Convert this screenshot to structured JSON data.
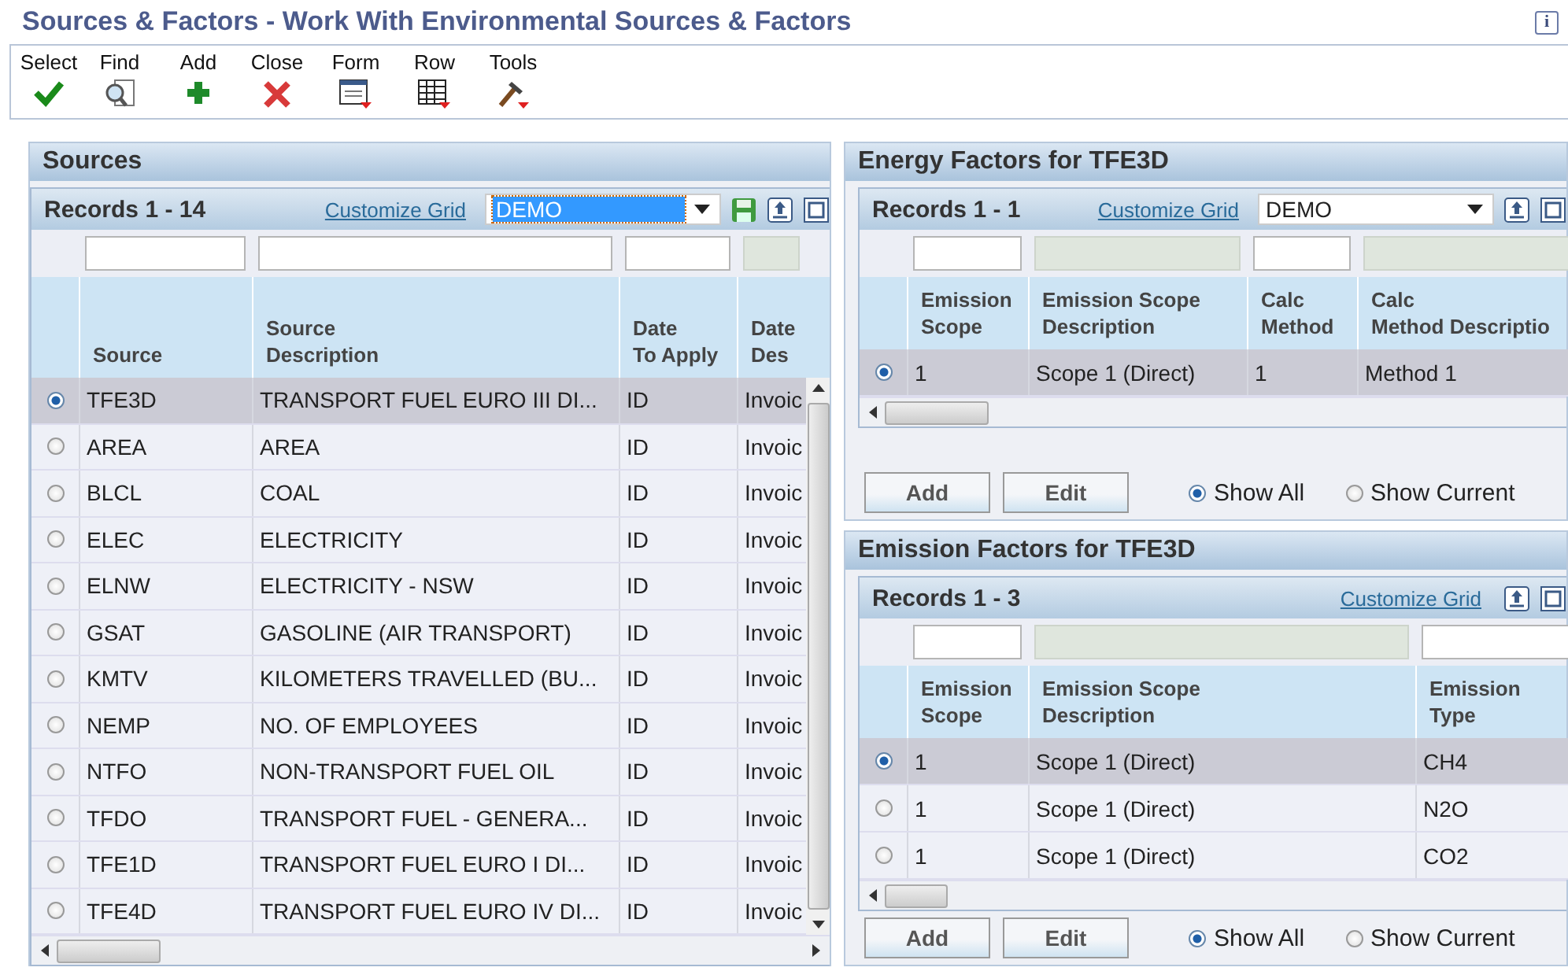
{
  "window": {
    "title": "Sources & Factors - Work With Environmental Sources & Factors",
    "info_icon": "i"
  },
  "toolbar": [
    {
      "label": "Select",
      "kind": "check"
    },
    {
      "label": "Find",
      "kind": "find"
    },
    {
      "label": "Add",
      "kind": "add"
    },
    {
      "label": "Close",
      "kind": "close"
    },
    {
      "label": "Form",
      "kind": "form"
    },
    {
      "label": "Row",
      "kind": "row"
    },
    {
      "label": "Tools",
      "kind": "tools"
    }
  ],
  "sources": {
    "title": "Sources",
    "records": "Records 1 - 14",
    "customize": "Customize Grid",
    "grid_format": {
      "value": "DEMO",
      "focused": true
    },
    "columns": [
      {
        "label": "Source",
        "filter_disabled": false
      },
      {
        "label": "Source\nDescription",
        "filter_disabled": false
      },
      {
        "label": "Date\nTo Apply",
        "filter_disabled": false
      },
      {
        "label": "Date\nDes",
        "filter_disabled": true
      }
    ],
    "rows": [
      {
        "selected": true,
        "cells": [
          "TFE3D",
          "TRANSPORT FUEL EURO III DI...",
          "ID",
          "Invoic"
        ]
      },
      {
        "selected": false,
        "cells": [
          "AREA",
          "AREA",
          "ID",
          "Invoic"
        ]
      },
      {
        "selected": false,
        "cells": [
          "BLCL",
          "COAL",
          "ID",
          "Invoic"
        ]
      },
      {
        "selected": false,
        "cells": [
          "ELEC",
          "ELECTRICITY",
          "ID",
          "Invoic"
        ]
      },
      {
        "selected": false,
        "cells": [
          "ELNW",
          "ELECTRICITY - NSW",
          "ID",
          "Invoic"
        ]
      },
      {
        "selected": false,
        "cells": [
          "GSAT",
          "GASOLINE (AIR TRANSPORT)",
          "ID",
          "Invoic"
        ]
      },
      {
        "selected": false,
        "cells": [
          "KMTV",
          "KILOMETERS TRAVELLED (BU...",
          "ID",
          "Invoic"
        ]
      },
      {
        "selected": false,
        "cells": [
          "NEMP",
          "NO. OF EMPLOYEES",
          "ID",
          "Invoic"
        ]
      },
      {
        "selected": false,
        "cells": [
          "NTFO",
          "NON-TRANSPORT FUEL OIL",
          "ID",
          "Invoic"
        ]
      },
      {
        "selected": false,
        "cells": [
          "TFDO",
          "TRANSPORT FUEL - GENERA...",
          "ID",
          "Invoic"
        ]
      },
      {
        "selected": false,
        "cells": [
          "TFE1D",
          "TRANSPORT FUEL EURO I DI...",
          "ID",
          "Invoic"
        ]
      },
      {
        "selected": false,
        "cells": [
          "TFE4D",
          "TRANSPORT FUEL EURO IV DI...",
          "ID",
          "Invoic"
        ]
      }
    ]
  },
  "energy_factors": {
    "title": "Energy Factors for TFE3D",
    "records": "Records 1 - 1",
    "customize": "Customize Grid",
    "grid_format": {
      "value": "DEMO",
      "focused": false
    },
    "columns": [
      {
        "label": "Emission\nScope",
        "filter_disabled": false
      },
      {
        "label": "Emission Scope\nDescription",
        "filter_disabled": true
      },
      {
        "label": "Calc\nMethod",
        "filter_disabled": false
      },
      {
        "label": "Calc\nMethod Descriptio",
        "filter_disabled": true
      }
    ],
    "rows": [
      {
        "selected": true,
        "cells": [
          "1",
          "Scope 1 (Direct)",
          "1",
          "Method 1"
        ]
      }
    ],
    "buttons": [
      "Add",
      "Edit"
    ],
    "options": [
      {
        "label": "Show All",
        "selected": true
      },
      {
        "label": "Show Current",
        "selected": false
      }
    ]
  },
  "emission_factors": {
    "title": "Emission Factors for TFE3D",
    "records": "Records 1 - 3",
    "customize": "Customize Grid",
    "columns": [
      {
        "label": "Emission\nScope",
        "filter_disabled": false
      },
      {
        "label": "Emission Scope\nDescription",
        "filter_disabled": true
      },
      {
        "label": "Emission\nType",
        "filter_disabled": false
      }
    ],
    "rows": [
      {
        "selected": true,
        "cells": [
          "1",
          "Scope 1 (Direct)",
          "CH4"
        ]
      },
      {
        "selected": false,
        "cells": [
          "1",
          "Scope 1 (Direct)",
          "N2O"
        ]
      },
      {
        "selected": false,
        "cells": [
          "1",
          "Scope 1 (Direct)",
          "CO2"
        ]
      }
    ],
    "buttons": [
      "Add",
      "Edit"
    ],
    "options": [
      {
        "label": "Show All",
        "selected": true
      },
      {
        "label": "Show Current",
        "selected": false
      }
    ]
  }
}
